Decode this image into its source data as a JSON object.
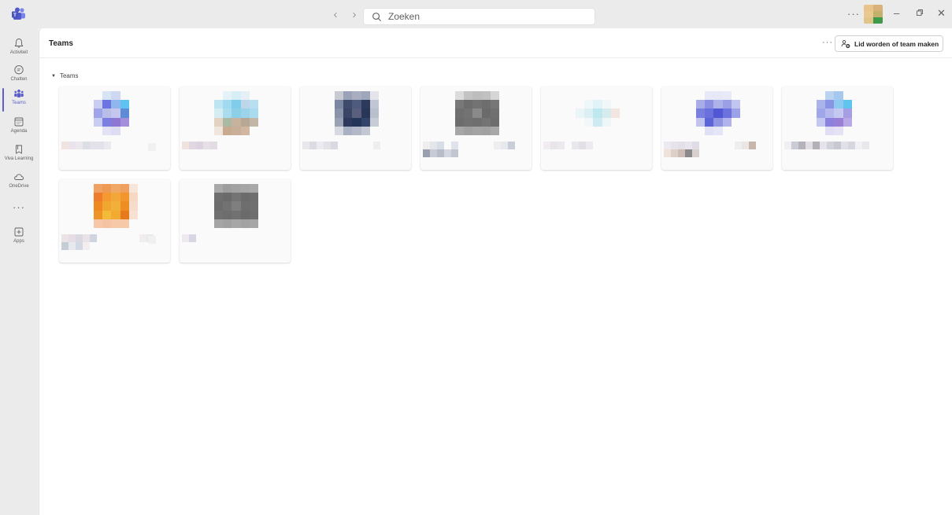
{
  "window": {
    "app": "Microsoft Teams",
    "search_placeholder": "Zoeken",
    "more_label": "···",
    "controls": {
      "minimize": "–",
      "restore": "▫",
      "close": "✕"
    }
  },
  "rail": {
    "items": [
      {
        "label": "Activiteit",
        "icon": "bell-icon"
      },
      {
        "label": "Chatten",
        "icon": "chat-icon"
      },
      {
        "label": "Teams",
        "icon": "teams-icon",
        "active": true
      },
      {
        "label": "Agenda",
        "icon": "calendar-icon"
      },
      {
        "label": "Viva Learning",
        "icon": "learning-icon"
      },
      {
        "label": "OneDrive",
        "icon": "cloud-icon"
      },
      {
        "label": "···",
        "icon": "more-icon"
      },
      {
        "label": "Apps",
        "icon": "apps-icon"
      }
    ]
  },
  "header": {
    "title": "Teams",
    "more_label": "···",
    "join_button": "Lid worden of team maken"
  },
  "section": {
    "label": "Teams"
  },
  "colors": {
    "accent": "#5b5fc7",
    "rail_bg": "#ebebeb",
    "content_bg": "#ffffff",
    "card_bg": "#fafafa"
  }
}
